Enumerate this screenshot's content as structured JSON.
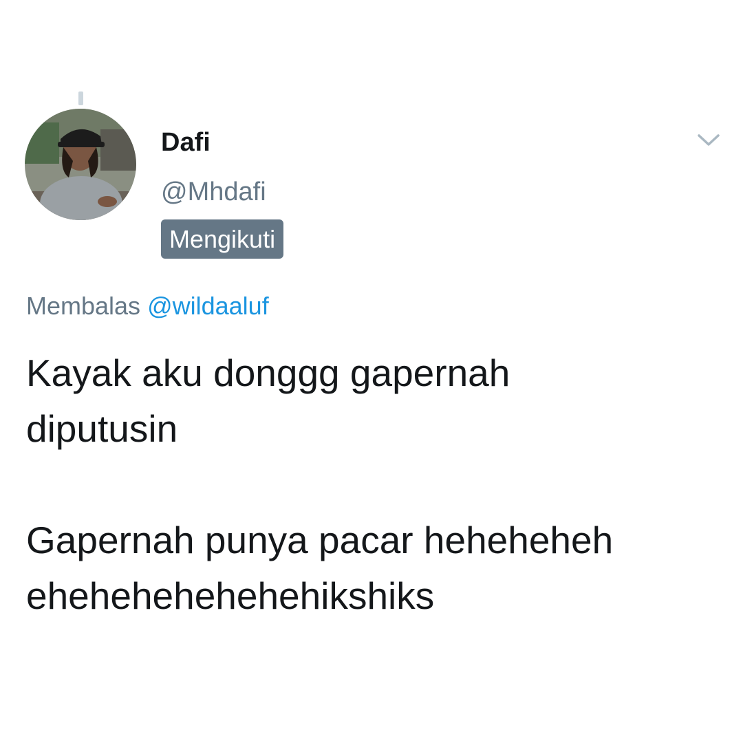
{
  "author": {
    "display_name": "Dafi",
    "handle": "@Mhdafi",
    "follow_status": "Mengikuti"
  },
  "reply": {
    "prefix": "Membalas",
    "mention": "@wildaaluf"
  },
  "tweet": {
    "line1": "Kayak aku donggg gapernah",
    "line2": "diputusin",
    "line3": "Gapernah punya pacar heheheheh",
    "line4": "ehehehehehehehikshiks"
  },
  "icons": {
    "menu": "chevron-down-icon",
    "avatar": "profile-photo"
  },
  "colors": {
    "text_primary": "#14171a",
    "text_secondary": "#657786",
    "link": "#1b95e0",
    "badge_bg": "#657786"
  }
}
